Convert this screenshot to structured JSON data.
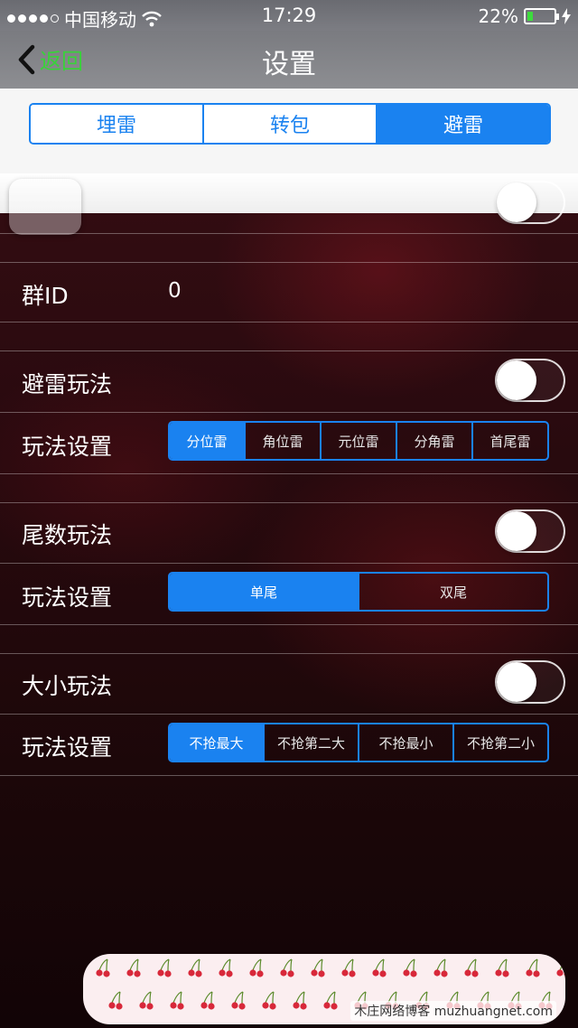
{
  "status_bar": {
    "carrier": "中国移动",
    "time": "17:29",
    "battery": "22%",
    "battery_level": 0.22
  },
  "nav": {
    "back_label": "返回",
    "title": "设置"
  },
  "top_tabs": {
    "items": [
      "埋雷",
      "转包",
      "避雷"
    ],
    "selected": "避雷"
  },
  "group_id": {
    "label": "群ID",
    "value": "0"
  },
  "sections": [
    {
      "toggle_label": "避雷玩法",
      "toggle_on": false,
      "setting_label": "玩法设置",
      "options": [
        "分位雷",
        "角位雷",
        "元位雷",
        "分角雷",
        "首尾雷"
      ],
      "selected": "分位雷"
    },
    {
      "toggle_label": "尾数玩法",
      "toggle_on": false,
      "setting_label": "玩法设置",
      "options": [
        "单尾",
        "双尾"
      ],
      "selected": "单尾"
    },
    {
      "toggle_label": "大小玩法",
      "toggle_on": false,
      "setting_label": "玩法设置",
      "options": [
        "不抢最大",
        "不抢第二大",
        "不抢最小",
        "不抢第二小"
      ],
      "selected": "不抢最大"
    }
  ],
  "watermark": {
    "text": "木庄网络博客 muzhuangnet.com"
  },
  "colors": {
    "accent": "#1a82f0",
    "back_label": "#39d23a",
    "battery_fill": "#3ddc3d"
  }
}
